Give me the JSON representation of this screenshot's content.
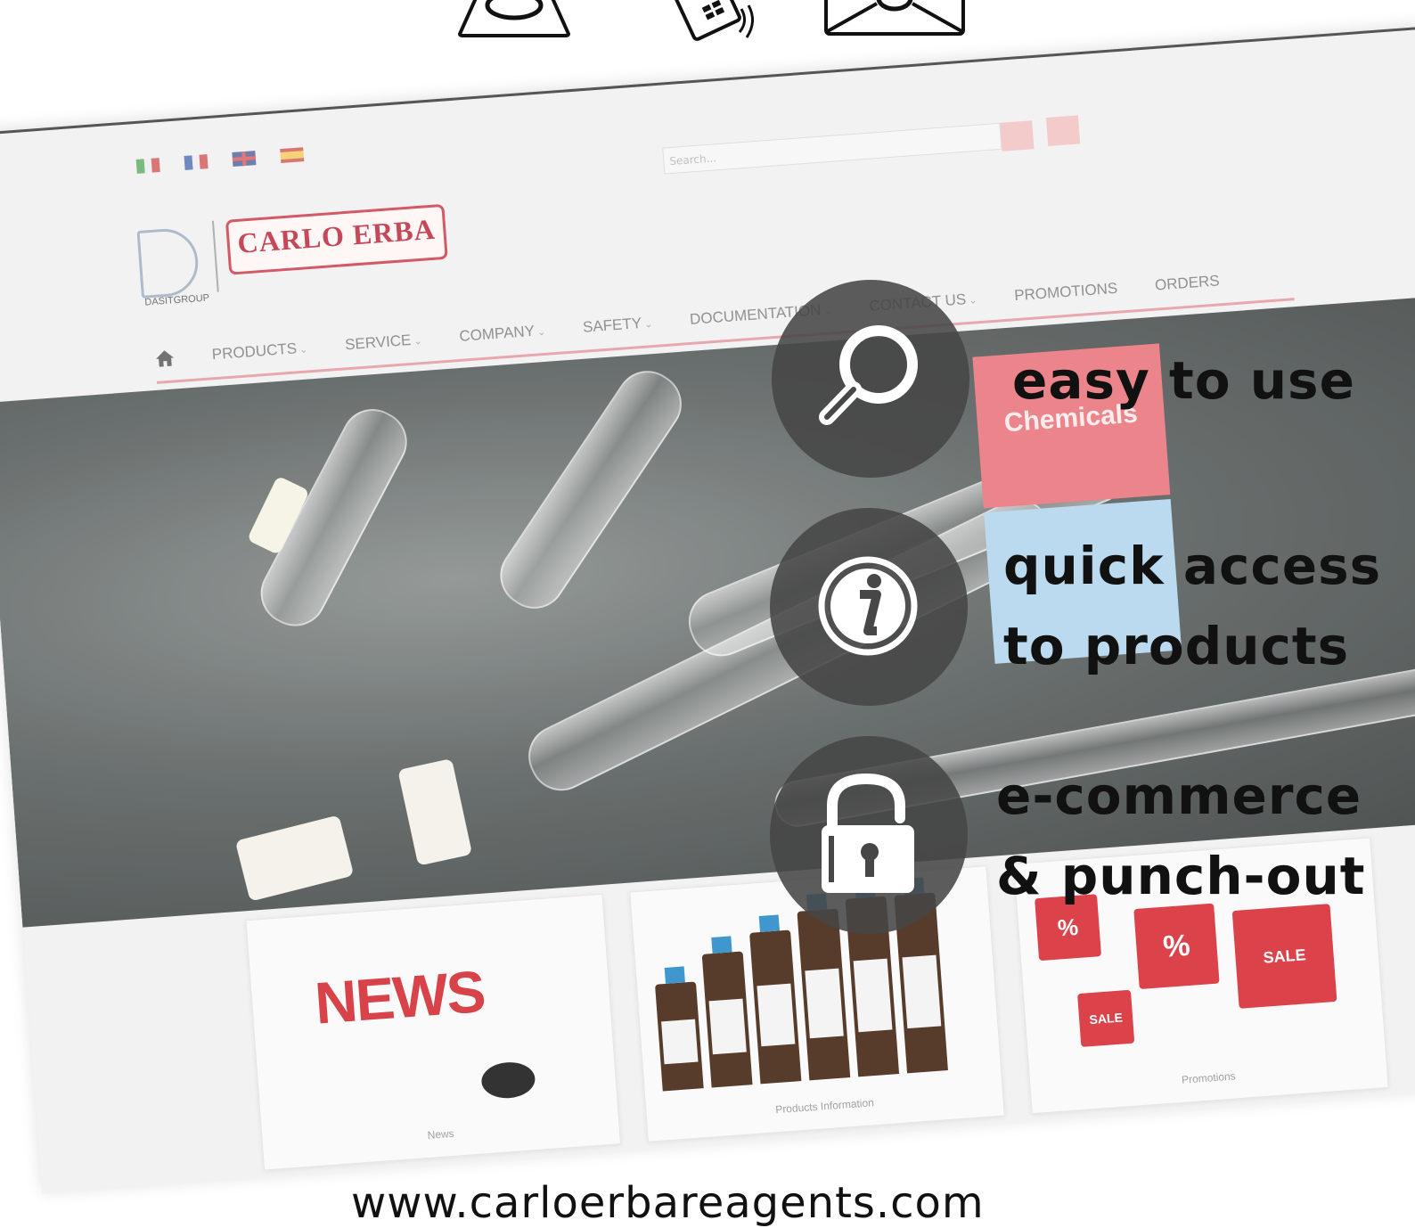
{
  "top_icons": [
    "user-icon",
    "phone-icon",
    "email-icon"
  ],
  "website": {
    "flags": [
      "italy-flag-icon",
      "france-flag-icon",
      "uk-flag-icon",
      "spain-flag-icon"
    ],
    "search_placeholder": "Search...",
    "logo_group_text": "DASITGROUP",
    "logo_brand_text": "CARLO ERBA",
    "nav": {
      "products": "PRODUCTS",
      "service": "SERVICE",
      "company": "COMPANY",
      "safety": "SAFETY",
      "documentation": "DOCUMENTATION",
      "contact": "CONTACT US",
      "promotions": "PROMOTIONS",
      "orders": "ORDERS"
    },
    "hero_tile_label": "Chemicals",
    "cards": {
      "news_word": "NEWS",
      "news_caption": "News",
      "products_caption": "Products Information",
      "promotions_caption": "Promotions"
    }
  },
  "features": {
    "easy": "easy to use",
    "quick_line1": "quick access",
    "quick_line2": "to products",
    "ecommerce_line1": "e-commerce",
    "ecommerce_line2": "& punch-out"
  },
  "url": "www.carloerbareagents.com"
}
